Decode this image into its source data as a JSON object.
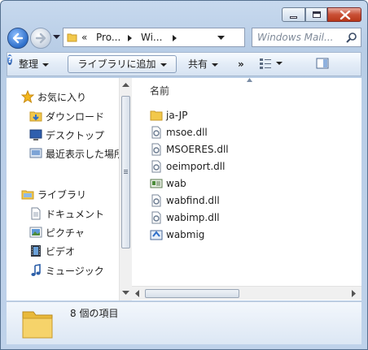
{
  "window": {
    "caption_buttons": [
      "minimize",
      "maximize",
      "close"
    ]
  },
  "navigation": {
    "breadcrumbs": [
      "«",
      "Pro...",
      "Wi..."
    ],
    "search_placeholder": "Windows Mail..."
  },
  "toolbar": {
    "organize": "整理",
    "add_to_library": "ライブラリに追加",
    "share": "共有",
    "more": "»"
  },
  "sidebar": {
    "favorites": {
      "label": "お気に入り",
      "items": [
        {
          "label": "ダウンロード",
          "icon": "download-folder-icon"
        },
        {
          "label": "デスクトップ",
          "icon": "desktop-icon"
        },
        {
          "label": "最近表示した場所",
          "icon": "recent-places-icon"
        }
      ]
    },
    "libraries": {
      "label": "ライブラリ",
      "items": [
        {
          "label": "ドキュメント",
          "icon": "documents-icon"
        },
        {
          "label": "ピクチャ",
          "icon": "pictures-icon"
        },
        {
          "label": "ビデオ",
          "icon": "videos-icon"
        },
        {
          "label": "ミュージック",
          "icon": "music-icon"
        }
      ]
    }
  },
  "filelist": {
    "column_header": "名前",
    "items": [
      {
        "name": "ja-JP",
        "icon": "folder-icon"
      },
      {
        "name": "msoe.dll",
        "icon": "dll-file-icon"
      },
      {
        "name": "MSOERES.dll",
        "icon": "dll-file-icon"
      },
      {
        "name": "oeimport.dll",
        "icon": "dll-file-icon"
      },
      {
        "name": "wab",
        "icon": "application-icon"
      },
      {
        "name": "wabfind.dll",
        "icon": "dll-file-icon"
      },
      {
        "name": "wabimp.dll",
        "icon": "dll-file-icon"
      },
      {
        "name": "wabmig",
        "icon": "application-icon"
      }
    ]
  },
  "details": {
    "item_count": "8 個の項目"
  },
  "colors": {
    "frame": "#bfd2ea",
    "close_button": "#c94f35",
    "folder": "#f2c84b"
  }
}
